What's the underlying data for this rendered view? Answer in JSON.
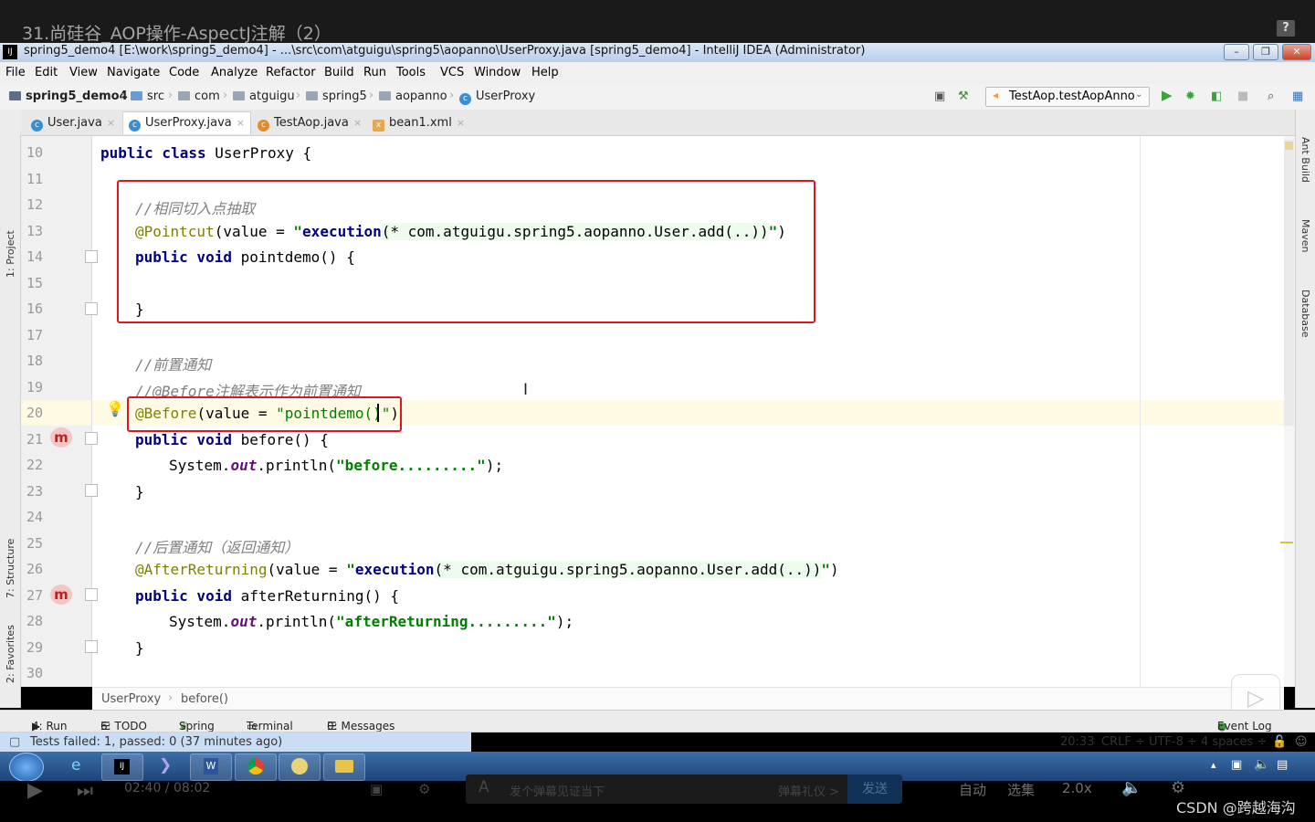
{
  "video": {
    "title": "31.尚硅谷_AOP操作-AspectJ注解（2）",
    "time": "02:40 / 08:02",
    "comment_placeholder": "发个弹幕见证当下",
    "danmaku_etiquette": "弹幕礼仪 >",
    "send": "发送",
    "auto": "自动",
    "episodes": "选集",
    "speed": "2.0x",
    "watermark": "CSDN @跨越海沟"
  },
  "window": {
    "title": "spring5_demo4 [E:\\work\\spring5_demo4] - ...\\src\\com\\atguigu\\spring5\\aopanno\\UserProxy.java [spring5_demo4] - IntelliJ IDEA (Administrator)"
  },
  "menu": [
    "File",
    "Edit",
    "View",
    "Navigate",
    "Code",
    "Analyze",
    "Refactor",
    "Build",
    "Run",
    "Tools",
    "VCS",
    "Window",
    "Help"
  ],
  "breadcrumbs": [
    "spring5_demo4",
    "src",
    "com",
    "atguigu",
    "spring5",
    "aopanno",
    "UserProxy"
  ],
  "run_config": "TestAop.testAopAnno",
  "tabs": [
    "User.java",
    "UserProxy.java",
    "TestAop.java",
    "bean1.xml"
  ],
  "side_tools": {
    "left": [
      "1: Project",
      "7: Structure",
      "2: Favorites"
    ],
    "right": [
      "Ant Build",
      "Maven",
      "Database"
    ]
  },
  "line_numbers": [
    "10",
    "11",
    "12",
    "13",
    "14",
    "15",
    "16",
    "17",
    "18",
    "19",
    "20",
    "21",
    "22",
    "23",
    "24",
    "25",
    "26",
    "27",
    "28",
    "29",
    "30"
  ],
  "code": {
    "l10_kw": "public class",
    "l10_name": " UserProxy {",
    "l12": "//相同切入点抽取",
    "l13_an": "@Pointcut",
    "l13_a": "(value = ",
    "l13_q1": "\"",
    "l13_s": "execution",
    "l13_b": "(* com.atguigu.spring5.aopanno.User.add(..))",
    "l13_q2": "\"",
    "l13_c": ")",
    "l14_kw": "public void",
    "l14_rest": " pointdemo() {",
    "l16": "}",
    "l18": "//前置通知",
    "l19": "//@Before注解表示作为前置通知",
    "l20_an": "@Before",
    "l20_a": "(value = ",
    "l20_s": "\"pointdemo()\"",
    "l20_c": ")",
    "l21_kw": "public void",
    "l21_rest": " before() {",
    "l22_a": "System.",
    "l22_f": "out",
    "l22_b": ".println(",
    "l22_s": "\"before.........\"",
    "l22_c": ");",
    "l23": "}",
    "l25": "//后置通知（返回通知）",
    "l26_an": "@AfterReturning",
    "l26_a": "(value = ",
    "l26_q1": "\"",
    "l26_s": "execution",
    "l26_b": "(* com.atguigu.spring5.aopanno.User.add(..))",
    "l26_q2": "\"",
    "l26_c": ")",
    "l27_kw": "public void",
    "l27_rest": " afterReturning() {",
    "l28_a": "System.",
    "l28_f": "out",
    "l28_b": ".println(",
    "l28_s": "\"afterReturning.........\"",
    "l28_c": ");",
    "l29": "}"
  },
  "editor_breadcrumb": [
    "UserProxy",
    "before()"
  ],
  "tool_windows": [
    "4: Run",
    "6: TODO",
    "Spring",
    "Terminal",
    "0: Messages",
    "Event Log"
  ],
  "status": {
    "message": "Tests failed: 1, passed: 0 (37 minutes ago)",
    "position": "20:33",
    "line_sep": "CRLF ÷",
    "encoding": "UTF-8 ÷",
    "indent": "4 spaces ÷"
  },
  "colors": {
    "highlight_box": "#e0161b",
    "keyword": "#000080",
    "string": "#008000",
    "annotation": "#808000"
  }
}
